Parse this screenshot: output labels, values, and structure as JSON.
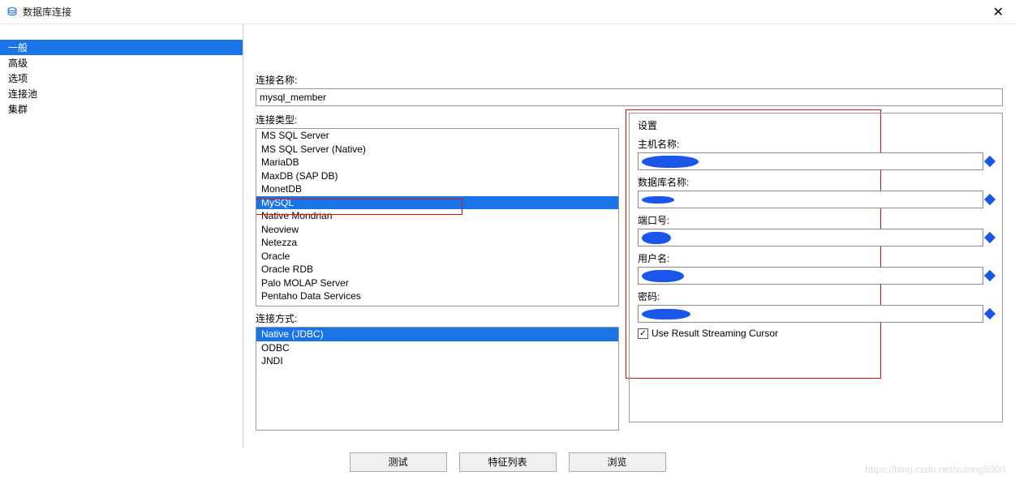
{
  "window": {
    "title": "数据库连接",
    "close": "✕"
  },
  "sidebar": {
    "items": [
      "一般",
      "高级",
      "选项",
      "连接池",
      "集群"
    ],
    "selected": 0
  },
  "conn_name_label": "连接名称:",
  "conn_name_value": "mysql_member",
  "conn_type_label": "连接类型:",
  "conn_types": [
    "MS SQL Server",
    "MS SQL Server (Native)",
    "MariaDB",
    "MaxDB (SAP DB)",
    "MonetDB",
    "MySQL",
    "Native Mondrian",
    "Neoview",
    "Netezza",
    "Oracle",
    "Oracle RDB",
    "Palo MOLAP Server",
    "Pentaho Data Services"
  ],
  "conn_type_selected": 5,
  "conn_method_label": "连接方式:",
  "conn_methods": [
    "Native (JDBC)",
    "ODBC",
    "JNDI"
  ],
  "conn_method_selected": 0,
  "settings": {
    "heading": "设置",
    "host_label": "主机名称:",
    "db_label": "数据库名称:",
    "port_label": "端口号:",
    "user_label": "用户名:",
    "pass_label": "密码:",
    "chk_label": "Use Result Streaming Cursor",
    "chk_checked": true
  },
  "footer": {
    "test": "测试",
    "features": "特征列表",
    "browse": "浏览"
  },
  "watermark": "https://blog.csdn.net/xulong5000"
}
